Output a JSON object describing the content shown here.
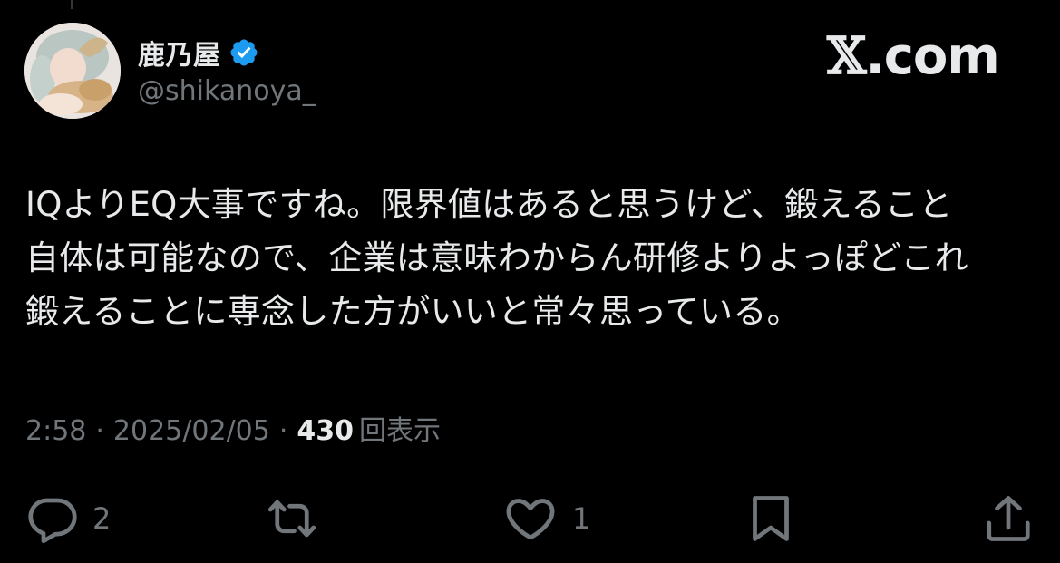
{
  "author": {
    "display_name": "鹿乃屋",
    "handle": "@shikanoya_",
    "verified": true
  },
  "brand": {
    "logo_text": "𝕏.com",
    "logo_x": "𝕏",
    "logo_suffix": ".com"
  },
  "tweet": {
    "text": "IQよりEQ大事ですね。限界値はあると思うけど、鍛えること\n自体は可能なので、企業は意味わからん研修よりよっぽどこれ\n鍛えることに専念した方がいいと常々思っている。"
  },
  "meta": {
    "time": "2:58",
    "separator": "·",
    "date": "2025/02/05",
    "views_count": "430",
    "views_label": "回表示"
  },
  "actions": {
    "reply": {
      "icon": "reply-icon",
      "count": "2"
    },
    "repost": {
      "icon": "repost-icon",
      "count": ""
    },
    "like": {
      "icon": "heart-icon",
      "count": "1"
    },
    "bookmark": {
      "icon": "bookmark-icon"
    },
    "share": {
      "icon": "share-icon"
    }
  },
  "colors": {
    "background": "#000000",
    "primary_text": "#e7e9ea",
    "secondary_text": "#71767b",
    "verified_blue": "#1d9bf0"
  }
}
